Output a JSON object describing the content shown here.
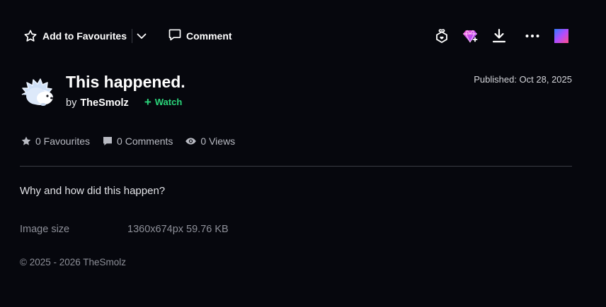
{
  "toolbar": {
    "favourite_label": "Add to Favourites",
    "comment_label": "Comment",
    "icons": {
      "favourite": "star-outline-icon",
      "dropdown": "chevron-down-icon",
      "comment": "comment-icon",
      "gift": "gift-badge-icon",
      "core": "gem-icon",
      "download": "download-icon",
      "more": "more-dots-icon",
      "app": "app-gradient-icon"
    }
  },
  "deviation": {
    "title": "This happened.",
    "by_label": "by",
    "author": "TheSmolz",
    "watch_label": "Watch",
    "published": "Published: Oct 28, 2025",
    "description": "Why and how did this happen?"
  },
  "stats": {
    "favourites": "0 Favourites",
    "comments": "0 Comments",
    "views": "0 Views"
  },
  "details": {
    "image_size_label": "Image size",
    "image_size_value": "1360x674px 59.76 KB"
  },
  "footer": {
    "copyright": "© 2025 - 2026 TheSmolz"
  },
  "colors": {
    "background": "#06070d",
    "watch_accent": "#2bd67b",
    "gem_pink": "#e23ee0",
    "gem_purple": "#9b4dff"
  }
}
